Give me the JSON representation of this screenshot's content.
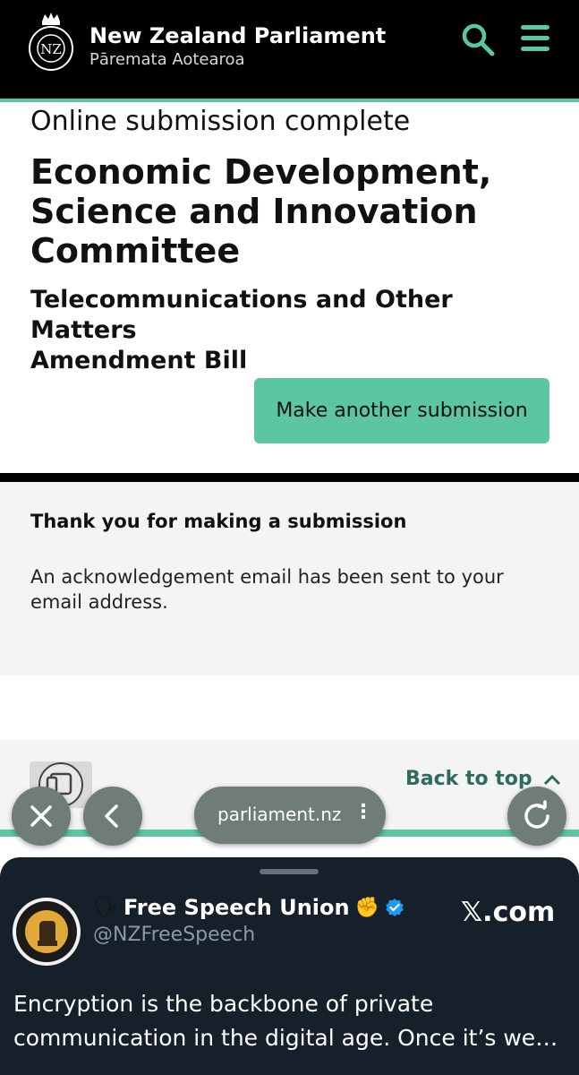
{
  "header": {
    "title": "New Zealand Parliament",
    "subtitle": "Pāremata Aotearoa",
    "crest_label": "NZ",
    "search_icon": "search-icon",
    "menu_icon": "menu-icon",
    "accent_color": "#5cc5a2"
  },
  "main": {
    "status": "Online submission complete",
    "committee_lines": [
      "Economic Development,",
      "Science and Innovation",
      "Committee"
    ],
    "bill_lines": [
      "Telecommunications and Other Matters",
      "Amendment Bill"
    ],
    "cta_label": "Make another submission"
  },
  "acknowledgement": {
    "title": "Thank you for making a submission",
    "body_lines": [
      "An acknowledgement email has been sent to your",
      "email address."
    ]
  },
  "footer": {
    "back_to_top": "Back to top"
  },
  "browser": {
    "url": "parliament.nz",
    "more_label": "⋮",
    "close_icon": "close-icon",
    "back_icon": "chevron-left-icon",
    "reload_icon": "reload-icon"
  },
  "tweet": {
    "speaker_emoji": "🗣",
    "author": "Free Speech Union",
    "fist_emoji": "✊",
    "handle": "@NZFreeSpeech",
    "source": "𝕏.com",
    "text_lines": [
      "Encryption is the backbone of private",
      "communication in the digital age. Once it’s wea..."
    ],
    "verified_color": "#1d9bf0"
  }
}
